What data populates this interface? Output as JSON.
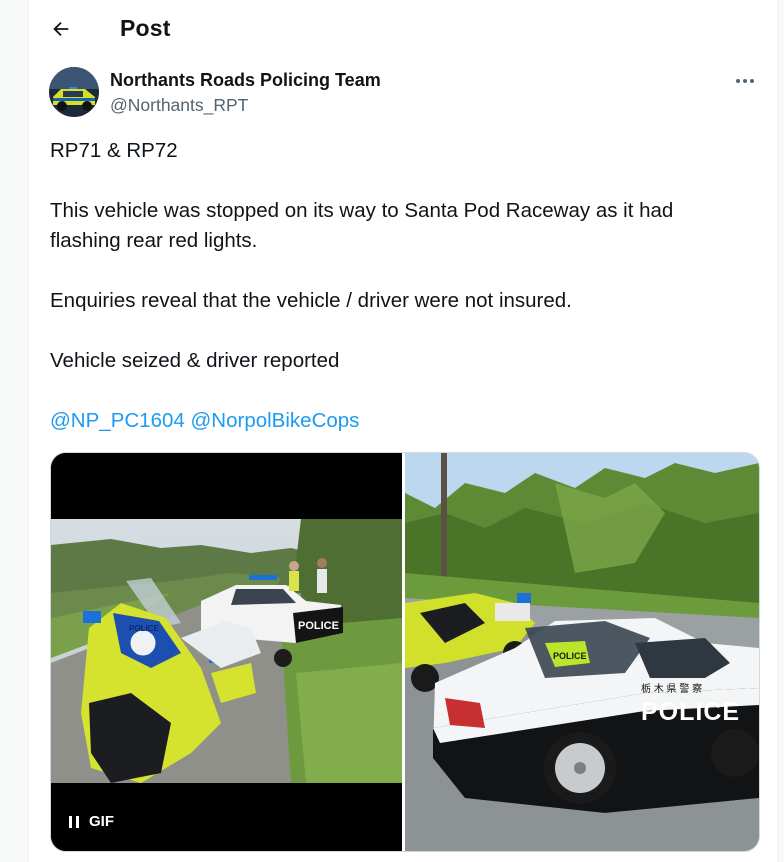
{
  "header": {
    "title": "Post"
  },
  "author": {
    "name": "Northants Roads Policing Team",
    "handle": "@Northants_RPT"
  },
  "tweet": {
    "line1": "RP71 & RP72",
    "line2": "This vehicle was stopped on its way to Santa Pod Raceway as it had",
    "line3": "flashing rear red lights.",
    "line4": "Enquiries reveal that the vehicle / driver were not insured.",
    "line5": "Vehicle seized & driver reported",
    "mentions": [
      "@NP_PC1604",
      "@NorpolBikeCops"
    ]
  },
  "media": {
    "gif_label": "GIF",
    "left_car_text": "POLICE",
    "right_car_text": "POLICE",
    "right_car_jp_text": "栃 木 県 警 察",
    "motorbike_text": "POLICE",
    "windshield_sign": "POLICE"
  },
  "colors": {
    "link": "#1d9bf0",
    "secondary_text": "#536471",
    "border": "#cfd9de"
  },
  "icons": {
    "back": "arrow-left-icon",
    "more": "more-horizontal-icon",
    "pause": "pause-icon"
  }
}
